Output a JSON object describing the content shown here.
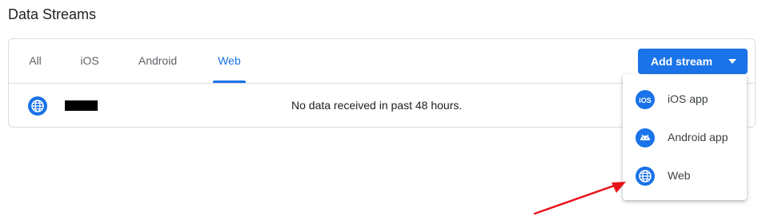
{
  "page": {
    "title": "Data Streams"
  },
  "tabs": [
    {
      "label": "All",
      "active": false
    },
    {
      "label": "iOS",
      "active": false
    },
    {
      "label": "Android",
      "active": false
    },
    {
      "label": "Web",
      "active": true
    }
  ],
  "toolbar": {
    "add_stream_label": "Add stream"
  },
  "stream": {
    "icon": "globe-icon",
    "name": "",
    "status": "No data received in past 48 hours."
  },
  "menu": {
    "items": [
      {
        "label": "iOS app",
        "icon": "ios-icon"
      },
      {
        "label": "Android app",
        "icon": "android-icon"
      },
      {
        "label": "Web",
        "icon": "globe-icon"
      }
    ]
  },
  "colors": {
    "accent": "#1a73e8",
    "annotation_arrow": "#e8131a"
  }
}
